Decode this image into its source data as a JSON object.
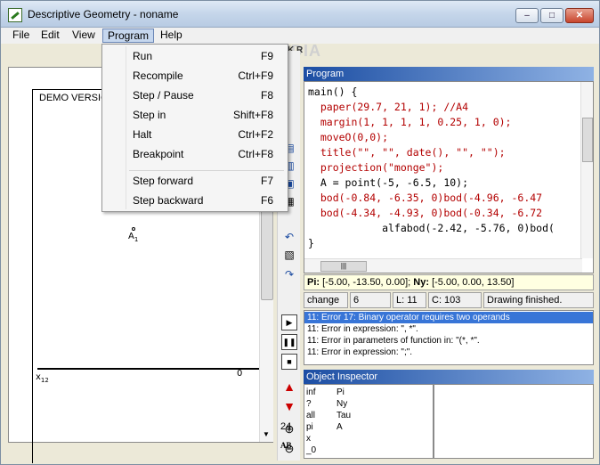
{
  "window": {
    "title": "Descriptive Geometry - noname",
    "minimize": "–",
    "maximize": "□",
    "close": "✕"
  },
  "menubar": [
    "File",
    "Edit",
    "View",
    "Program",
    "Help"
  ],
  "watermark": "SOFTPEDIA",
  "program_menu": {
    "items": [
      {
        "label": "Run",
        "shortcut": "F9"
      },
      {
        "label": "Recompile",
        "shortcut": "Ctrl+F9"
      },
      {
        "label": "Step / Pause",
        "shortcut": "F8"
      },
      {
        "label": "Step in",
        "shortcut": "Shift+F8"
      },
      {
        "label": "Halt",
        "shortcut": "Ctrl+F2"
      },
      {
        "label": "Breakpoint",
        "shortcut": "Ctrl+F8"
      },
      {
        "label": "Step forward",
        "shortcut": "F7"
      },
      {
        "label": "Step backward",
        "shortcut": "F6"
      }
    ]
  },
  "drawing": {
    "demo_label": "DEMO VERSION",
    "x_label": "x",
    "x_sub": "12",
    "zero_label": "0",
    "point_label": "A",
    "point_sub": "1"
  },
  "toolbar": {
    "zoom_value": "24",
    "ab_label": "AB",
    "top_labels": "K  R"
  },
  "program": {
    "header": "Program",
    "code": [
      "main() {",
      "  paper(29.7, 21, 1); //A4",
      "  margin(1, 1, 1, 1, 0.25, 1, 0);",
      "  moveO(0,0);",
      "  title(\"\", \"\", date(), \"\", \"\");",
      "  projection(\"monge\");",
      "  A = point(-5, -6.5, 10);",
      "  bod(-0.84, -6.35, 0)bod(-4.96, -6.47",
      "  bod(-4.34, -4.93, 0)bod(-0.34, -6.72",
      "            alfabod(-2.42, -5.76, 0)bod(",
      "}"
    ]
  },
  "coords": {
    "pi_label": "Pi:",
    "pi_value": "[-5.00, -13.50, 0.00];",
    "ny_label": "Ny:",
    "ny_value": "[-5.00, 0.00, 13.50]"
  },
  "status": {
    "mode": "change",
    "num": "6",
    "line": "L:  11",
    "col": "C: 103",
    "message": "Drawing finished."
  },
  "errors": [
    "11: Error 17: Binary operator requires two operands",
    "11: Error in expression: \", *\".",
    "11: Error in parameters of function in: \"(*, *\".",
    "11: Error in expression: \";\"."
  ],
  "inspector": {
    "header": "Object Inspector",
    "rows": [
      {
        "k": "inf",
        "v": "Pi"
      },
      {
        "k": "?",
        "v": "Ny"
      },
      {
        "k": "all",
        "v": "Tau"
      },
      {
        "k": "pi",
        "v": "A"
      },
      {
        "k": "x",
        "v": ""
      },
      {
        "k": "_0",
        "v": ""
      }
    ]
  }
}
